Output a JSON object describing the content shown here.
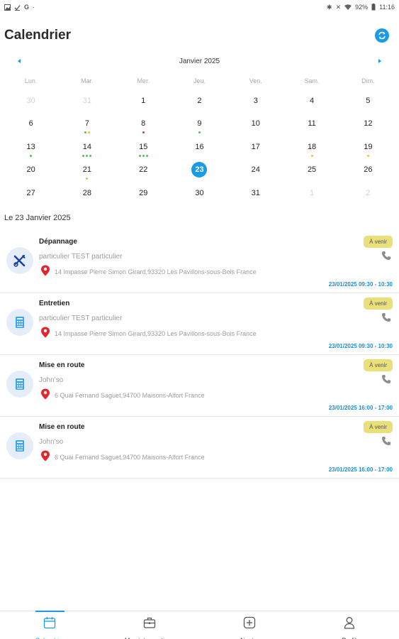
{
  "statusbar": {
    "left_icons": [
      "image-icon",
      "check-icon",
      "google-icon",
      "dot-icon"
    ],
    "battery": "92%",
    "time": "11:16"
  },
  "header": {
    "title": "Calendrier"
  },
  "calendar": {
    "month": "Janvier 2025",
    "weekdays": [
      "Lun.",
      "Mar.",
      "Mer.",
      "Jeu.",
      "Ven.",
      "Sam.",
      "Dim."
    ],
    "days": [
      {
        "n": "30",
        "other": true
      },
      {
        "n": "31",
        "other": true
      },
      {
        "n": "1"
      },
      {
        "n": "2"
      },
      {
        "n": "3"
      },
      {
        "n": "4"
      },
      {
        "n": "5"
      },
      {
        "n": "6"
      },
      {
        "n": "7",
        "dots": [
          "#5cb85c",
          "#e8c23a"
        ]
      },
      {
        "n": "8",
        "dots": [
          "#d9383a"
        ]
      },
      {
        "n": "9",
        "dots": [
          "#5cb85c"
        ]
      },
      {
        "n": "10"
      },
      {
        "n": "11"
      },
      {
        "n": "12"
      },
      {
        "n": "13",
        "dots": [
          "#5cb85c"
        ]
      },
      {
        "n": "14",
        "dots": [
          "#5cb85c",
          "#5cb85c",
          "#5cb85c"
        ]
      },
      {
        "n": "15",
        "dots": [
          "#5cb85c",
          "#5cb85c",
          "#5cb85c"
        ]
      },
      {
        "n": "16"
      },
      {
        "n": "17"
      },
      {
        "n": "18",
        "dots": [
          "#e8c23a"
        ]
      },
      {
        "n": "19",
        "dots": [
          "#e8c23a"
        ]
      },
      {
        "n": "20"
      },
      {
        "n": "21",
        "dots": [
          "#e8c23a"
        ]
      },
      {
        "n": "22"
      },
      {
        "n": "23",
        "selected": true
      },
      {
        "n": "24"
      },
      {
        "n": "25"
      },
      {
        "n": "26"
      },
      {
        "n": "27"
      },
      {
        "n": "28"
      },
      {
        "n": "29"
      },
      {
        "n": "30"
      },
      {
        "n": "31"
      },
      {
        "n": "1",
        "other": true
      },
      {
        "n": "2",
        "other": true
      }
    ]
  },
  "day_title": "Le 23 Janvier 2025",
  "events": [
    {
      "title": "Dépannage",
      "client": "particulier TEST particulier",
      "address": "14 Impasse Pierre Simon Girard,93320 Les Pavillons-sous-Bois France",
      "badge": "À venir",
      "time": "23/01/2025 09:30 - 10:30",
      "icon": "tools-icon"
    },
    {
      "title": "Entretien",
      "client": "particulier TEST particulier",
      "address": "14 Impasse Pierre Simon Girard,93320 Les Pavillons-sous-Bois France",
      "badge": "À venir",
      "time": "23/01/2025 09:30 - 10:30",
      "icon": "appliance-icon"
    },
    {
      "title": "Mise en route",
      "client": "John'so",
      "address": "6 Quai Fernand Saguet,94700 Maisons-Alfort France",
      "badge": "À venir",
      "time": "23/01/2025 16:00 - 17:00",
      "icon": "appliance-icon"
    },
    {
      "title": "Mise en route",
      "client": "John'so",
      "address": "6 Quai Fernand Saguet,94700 Maisons-Alfort France",
      "badge": "À venir",
      "time": "23/01/2025 16:00 - 17:00",
      "icon": "appliance-icon"
    }
  ],
  "nav": [
    {
      "label": "Calendrier",
      "icon": "calendar-icon",
      "active": true
    },
    {
      "label": "Mes interventions",
      "icon": "briefcase-icon"
    },
    {
      "label": "Ajouter",
      "icon": "add-icon"
    },
    {
      "label": "Profil",
      "icon": "person-icon"
    }
  ],
  "colors": {
    "accent": "#1a9be6",
    "badge": "#e9e07a",
    "pin": "#e2262f"
  }
}
